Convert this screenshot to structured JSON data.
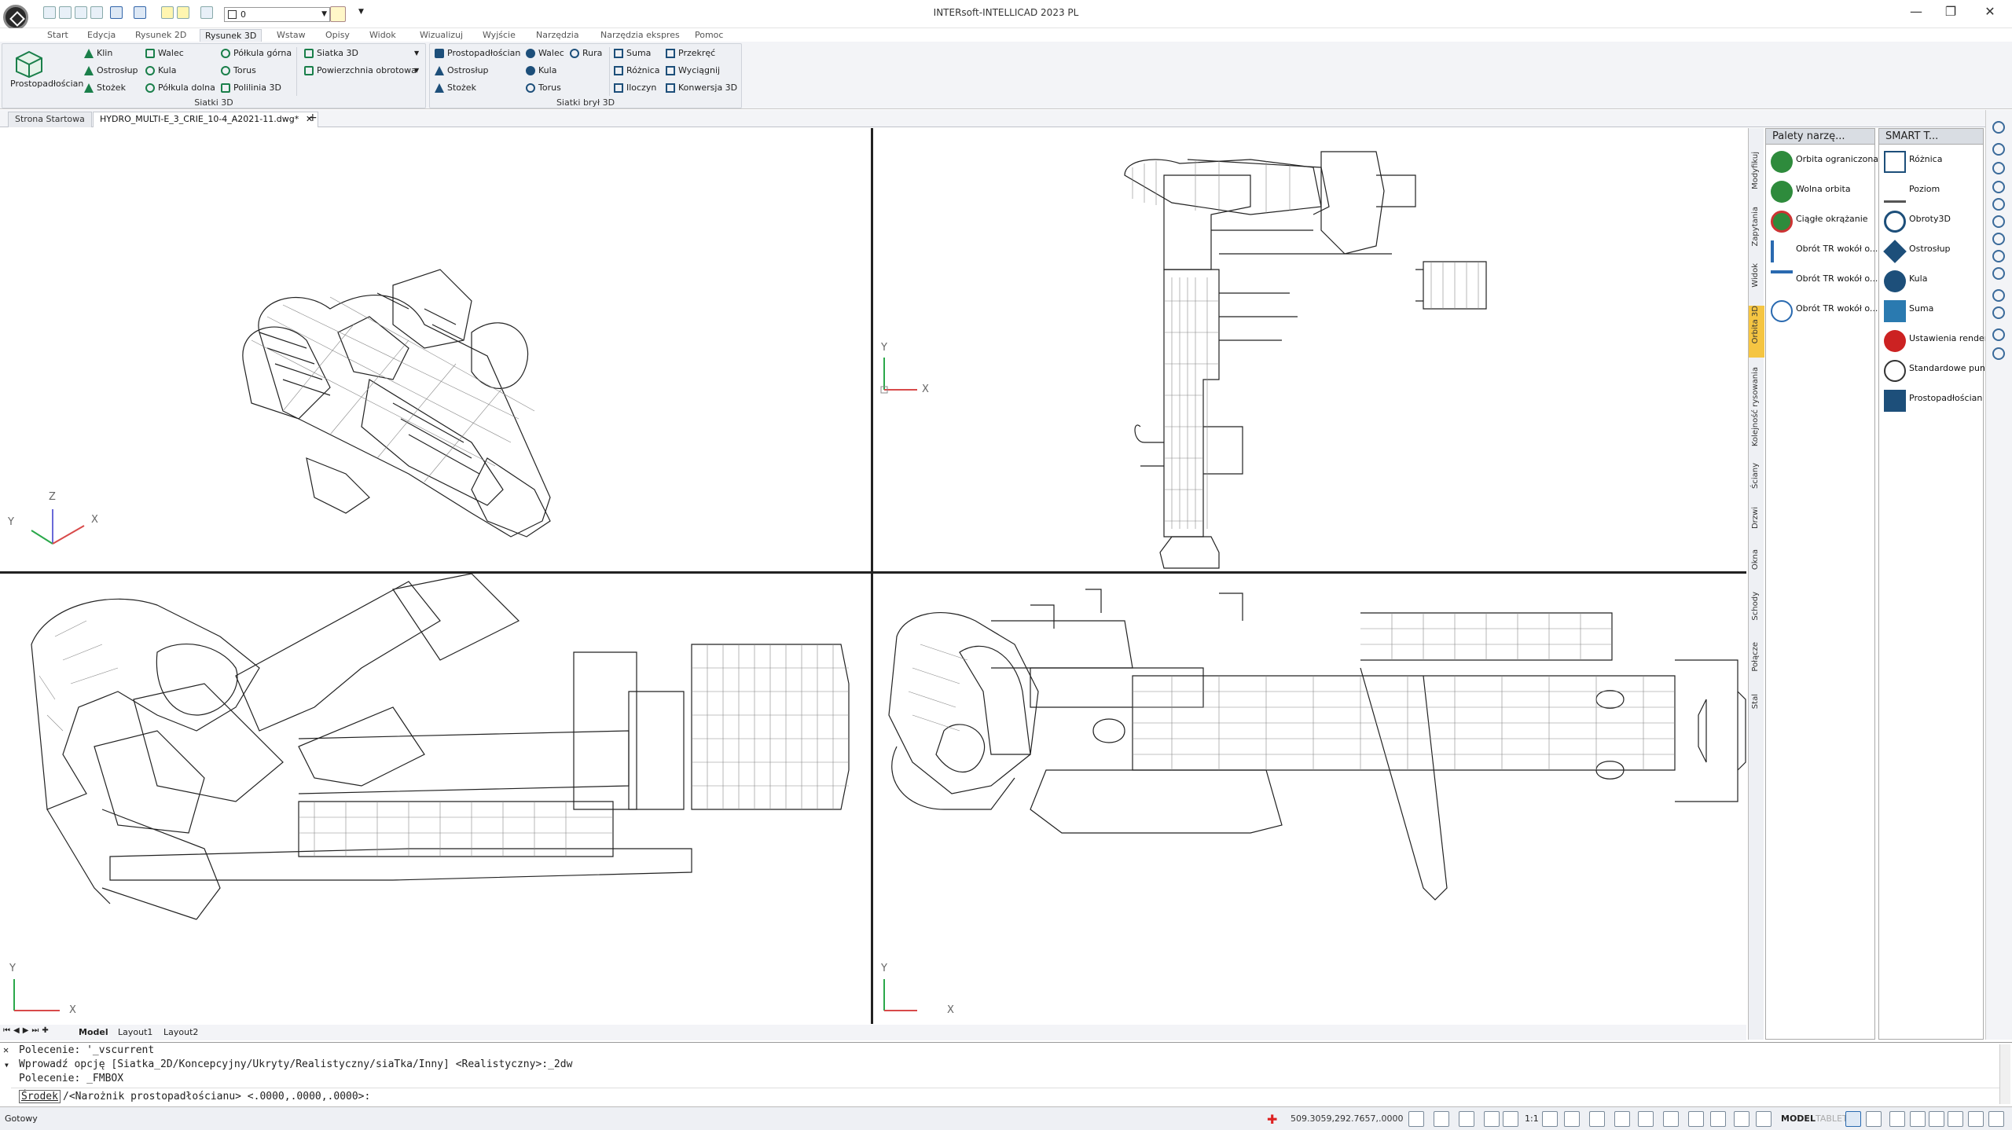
{
  "window": {
    "title": "INTERsoft-INTELLICAD 2023 PL",
    "minimize": "—",
    "restore": "❐",
    "close": "✕",
    "layer_value": "0"
  },
  "menu": [
    "Start",
    "Edycja",
    "Rysunek 2D",
    "Rysunek 3D",
    "Wstaw",
    "Opisy",
    "Widok",
    "Wizualizuj",
    "Wyjście",
    "Narzędzia",
    "Narzędzia ekspres",
    "Pomoc"
  ],
  "ribbon": {
    "big_button": "Prostopadłościan",
    "siatki3d": {
      "title": "Siatki 3D",
      "col1": [
        "Klin",
        "Ostrosłup",
        "Stożek"
      ],
      "col2": [
        "Walec",
        "Kula",
        "Półkula dolna"
      ],
      "col3": [
        "Półkula górna",
        "Torus",
        "Polilinia 3D"
      ],
      "col4": [
        "Siatka 3D",
        "Powierzchnia obrotowa"
      ]
    },
    "bryly": {
      "title": "Siatki brył 3D",
      "col1": [
        "Prostopadłościan",
        "Ostrosłup",
        "Stożek"
      ],
      "col2": [
        "Walec",
        "Kula",
        "Torus"
      ],
      "col3": [
        "Rura"
      ],
      "col4": [
        "Suma",
        "Różnica",
        "Iloczyn"
      ],
      "col5": [
        "Przekręć",
        "Wyciągnij",
        "Konwersja 3D"
      ]
    }
  },
  "tabs": {
    "start": "Strona Startowa",
    "doc": "HYDRO_MULTI-E_3_CRIE_10-4_A2021-11.dwg*",
    "close": "✕",
    "plus": "+"
  },
  "layouts": [
    "Model",
    "Layout1",
    "Layout2"
  ],
  "axes": {
    "x": "X",
    "y": "Y",
    "z": "Z"
  },
  "side_tabs": [
    "Modyfikuj",
    "Zapytania",
    "Widok",
    "Orbita 3D",
    "Kolejność rysowania",
    "Ściany",
    "Drzwi",
    "Okna",
    "Schody",
    "Połącze",
    "Stal"
  ],
  "palette1": {
    "title": "Palety narzę...",
    "items": [
      "Orbita ograniczona",
      "Wolna orbita",
      "Ciągłe okrążanie",
      "Obrót TR wokół o...",
      "Obrót TR wokół o...",
      "Obrót TR wokół o..."
    ]
  },
  "palette2": {
    "title": "SMART T...",
    "items": [
      "Różnica",
      "Poziom",
      "Obroty3D",
      "Ostrosłup",
      "Kula",
      "Suma",
      "Ustawienia render...",
      "Standardowe pun...",
      "Prostopadłościan"
    ]
  },
  "command": {
    "line1": "Polecenie: '_vscurrent",
    "line2": "Wprowadź opcję [Siatka_2D/Koncepcyjny/Ukryty/Realistyczny/siaTka/Inny] <Realistyczny>:_2dw",
    "line3": "Polecenie: _FMBOX",
    "prompt_option": "Środek",
    "prompt_rest": "/<Narożnik prostopadłościanu> <.0000,.0000,.0000>:"
  },
  "status": {
    "ready": "Gotowy",
    "coords": "509.3059,292.7657,.0000",
    "scale": "1:1",
    "model": "MODEL",
    "tablet": "TABLET"
  }
}
